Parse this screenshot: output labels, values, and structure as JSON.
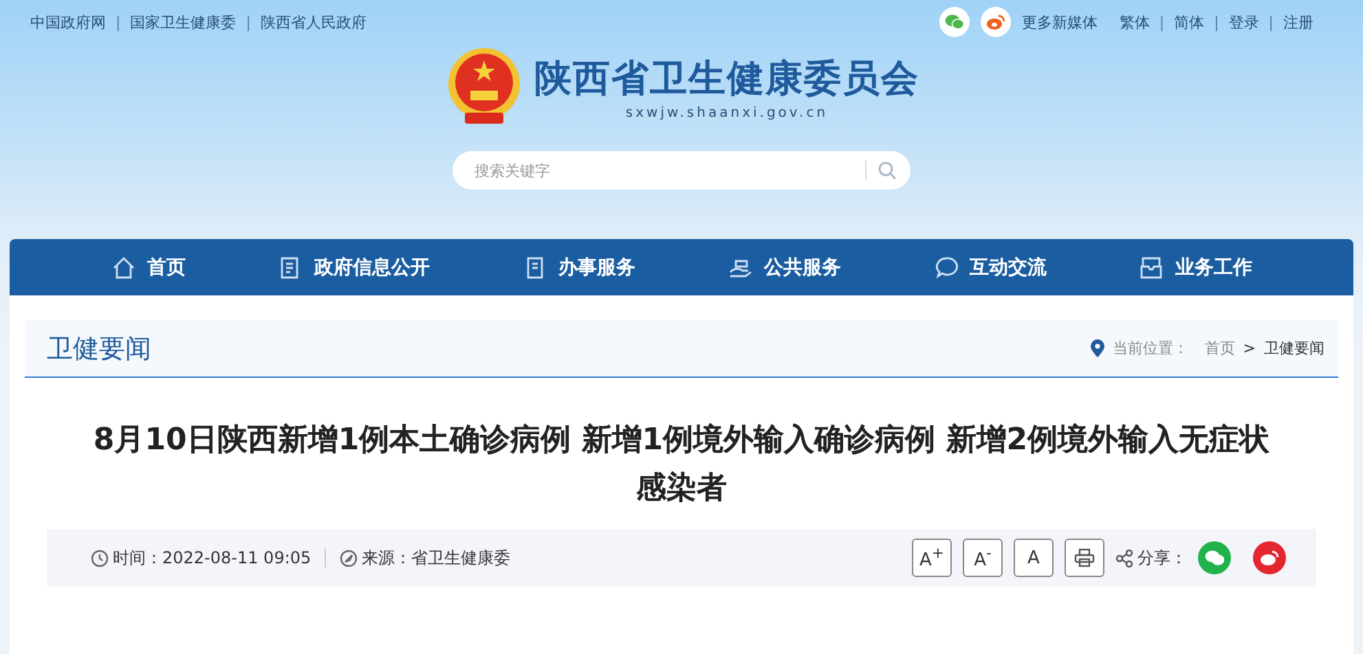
{
  "top_links": [
    {
      "kind": "link",
      "label": "中国政府网"
    },
    {
      "kind": "separator",
      "label": "|"
    },
    {
      "kind": "link",
      "label": "国家卫生健康委"
    },
    {
      "kind": "separator",
      "label": "|"
    },
    {
      "kind": "link",
      "label": "陕西省人民政府"
    }
  ],
  "top_right": {
    "media_label": "更多新媒体",
    "links": [
      {
        "kind": "link",
        "label": "繁体"
      },
      {
        "kind": "separator",
        "label": "|"
      },
      {
        "kind": "link",
        "label": "简体"
      },
      {
        "kind": "separator",
        "label": "|"
      },
      {
        "kind": "link",
        "label": "登录"
      },
      {
        "kind": "separator",
        "label": "|"
      },
      {
        "kind": "link",
        "label": "注册"
      }
    ]
  },
  "site": {
    "title": "陕西省卫生健康委员会",
    "domain": "sxwjw.shaanxi.gov.cn"
  },
  "search": {
    "placeholder": "搜索关键字"
  },
  "nav": [
    {
      "label": "首页",
      "kind": "home"
    },
    {
      "label": "政府信息公开",
      "kind": "doc"
    },
    {
      "label": "办事服务",
      "kind": "book"
    },
    {
      "label": "公共服务",
      "kind": "hand"
    },
    {
      "label": "互动交流",
      "kind": "chat"
    },
    {
      "label": "业务工作",
      "kind": "tray"
    }
  ],
  "section": {
    "title": "卫健要闻",
    "location_label": "当前位置：",
    "breadcrumb": [
      "首页",
      "卫健要闻"
    ],
    "separator": ">"
  },
  "article": {
    "title": "8月10日陕西新增1例本土确诊病例 新增1例境外输入确诊病例 新增2例境外输入无症状感染者",
    "time": "时间：2022-08-11 09:05",
    "source": "来源：省卫生健康委",
    "font_buttons": [
      "A$^{+}$",
      "A$^{-}$",
      "A"
    ],
    "share_label": "分享："
  }
}
